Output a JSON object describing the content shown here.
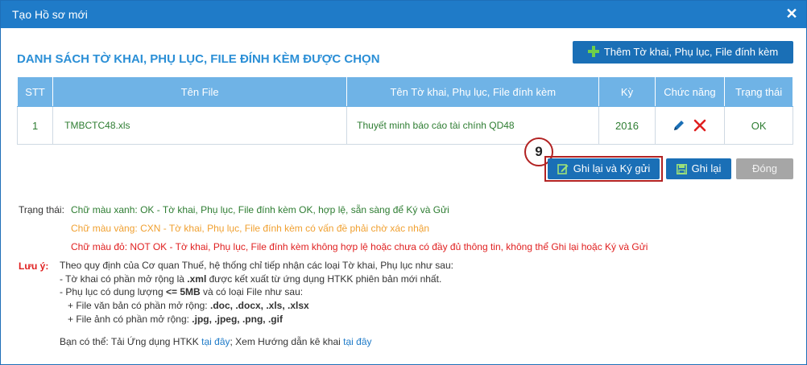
{
  "window": {
    "title": "Tạo Hồ sơ mới",
    "close_symbol": "✕"
  },
  "section": {
    "heading": "DANH SÁCH TỜ KHAI, PHỤ LỤC, FILE ĐÍNH KÈM ĐƯỢC CHỌN"
  },
  "add_button": {
    "label": "Thêm Tờ khai, Phụ lục, File đính kèm",
    "icon": "plus-icon"
  },
  "table": {
    "headers": {
      "stt": "STT",
      "file": "Tên File",
      "name": "Tên Tờ khai, Phụ lục, File đính kèm",
      "ky": "Kỳ",
      "actions": "Chức năng",
      "status": "Trạng thái"
    },
    "rows": [
      {
        "stt": "1",
        "file": "TMBCTC48.xls",
        "name": "Thuyết minh báo cáo tài chính QD48",
        "ky": "2016",
        "status": "OK"
      }
    ]
  },
  "step_marker": "9",
  "buttons": {
    "sign": {
      "label": "Ghi lại và Ký gửi",
      "icon": "edit-sign-icon"
    },
    "save": {
      "label": "Ghi lại",
      "icon": "save-icon"
    },
    "close": {
      "label": "Đóng"
    }
  },
  "status_legend": {
    "label": "Trạng thái:",
    "green": "Chữ màu xanh: OK - Tờ khai, Phụ lục, File đính kèm OK, hợp lệ, sẵn sàng để Ký và Gửi",
    "yellow": "Chữ màu vàng: CXN - Tờ khai, Phụ lục, File đính kèm có vấn đề phải chờ xác nhận",
    "red": "Chữ màu đỏ: NOT OK - Tờ khai, Phụ lục, File đính kèm không hợp lệ hoặc chưa có đầy đủ thông tin, không thể Ghi lại hoặc Ký và Gửi"
  },
  "notes": {
    "label": "Lưu ý:",
    "intro": "Theo quy định của Cơ quan Thuế, hệ thống chỉ tiếp nhận các loại Tờ khai, Phụ lục như sau:",
    "line1_pre": "- Tờ khai có phần mở rộng là ",
    "line1_bold": ".xml",
    "line1_post": " được kết xuất từ ứng dụng HTKK phiên bản mới nhất.",
    "line2_pre": "- Phụ lục có dung lượng ",
    "line2_bold": "<= 5MB",
    "line2_post": " và có loại File như sau:",
    "line3_pre": "+ File văn bản có phần mở rộng: ",
    "line3_bold": ".doc, .docx, .xls, .xlsx",
    "line4_pre": "+ File ảnh có phần mở rộng: ",
    "line4_bold": ".jpg, .jpeg, .png, .gif",
    "download_pre": "Bạn có thể: Tải Ứng dụng HTKK ",
    "download_link": "tại đây",
    "guide_pre": "; Xem Hướng dẫn kê khai ",
    "guide_link": "tại đây"
  },
  "colors": {
    "title_bar": "#1f7bc8",
    "heading": "#2b8fd6",
    "button": "#1a6fb6",
    "table_header": "#6fb3e6",
    "ok_green": "#2e7d32",
    "warn_orange": "#f0a030",
    "error_red": "#e02020",
    "marker_red": "#b22222"
  }
}
